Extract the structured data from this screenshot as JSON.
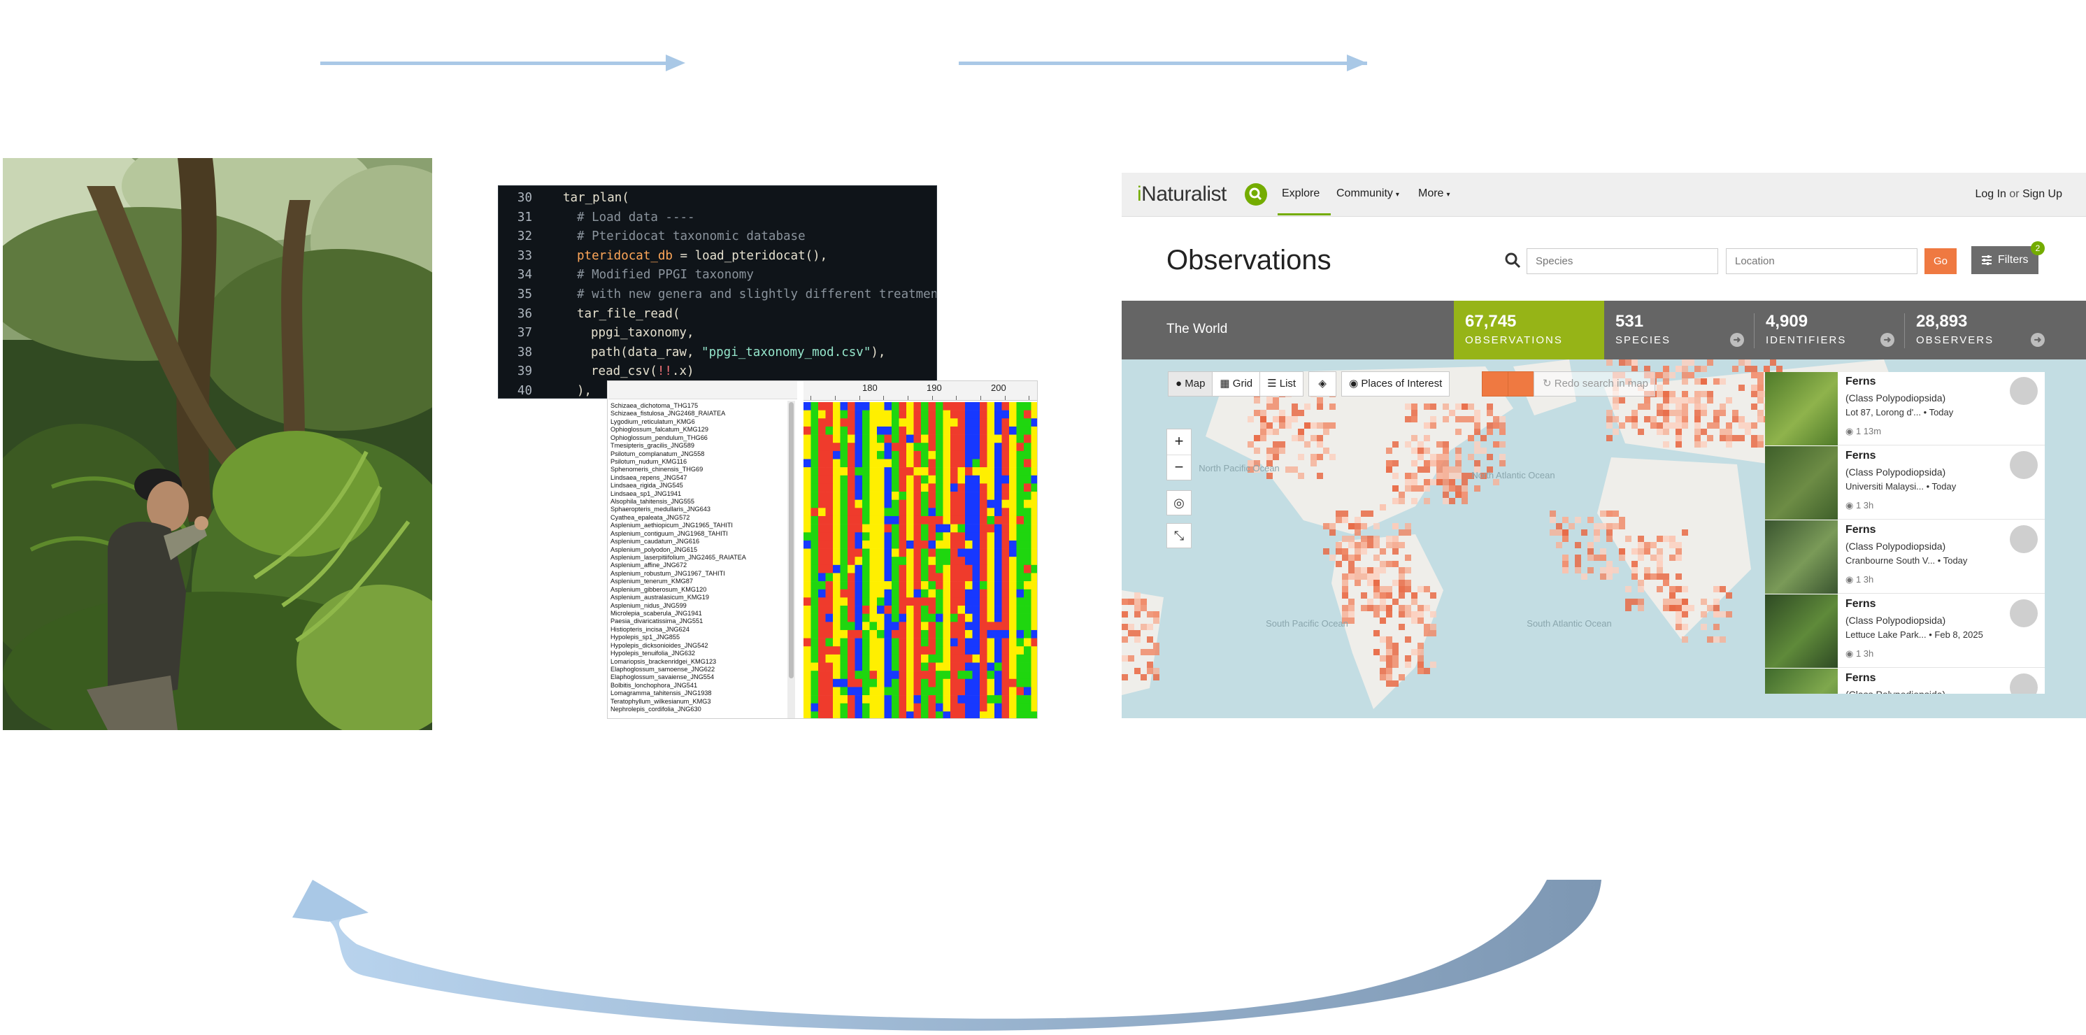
{
  "code": {
    "lines": [
      {
        "num": "30",
        "text": "tar_plan("
      },
      {
        "num": "31",
        "text": "# Load data ----"
      },
      {
        "num": "32",
        "text": "# Pteridocat taxonomic database"
      },
      {
        "num": "33",
        "text_a": "pteridocat_db",
        "text_b": " = load_pteridocat(),"
      },
      {
        "num": "34",
        "text": "# Modified PPGI taxonomy"
      },
      {
        "num": "35",
        "text": "# with new genera and slightly different treatments"
      },
      {
        "num": "36",
        "text": "tar_file_read("
      },
      {
        "num": "37",
        "text": "ppgi_taxonomy,"
      },
      {
        "num": "38",
        "text_a": "path(data_raw, ",
        "text_b": "\"ppgi_taxonomy_mod.csv\"",
        "text_c": "),"
      },
      {
        "num": "39",
        "text_a": "read_csv(",
        "text_b": "!!",
        "text_c": ".x)"
      },
      {
        "num": "40",
        "text": "),"
      }
    ]
  },
  "alignment": {
    "ruler": [
      "180",
      "190",
      "200"
    ],
    "taxa": [
      "Schizaea_dichotoma_THG175",
      "Schizaea_fistulosa_JNG2468_RAIATEA",
      "Lygodium_reticulatum_KMG6",
      "Ophioglossum_falcatum_KMG129",
      "Ophioglossum_pendulum_THG66",
      "Tmesipteris_gracilis_JNG589",
      "Psilotum_complanatum_JNG558",
      "Psilotum_nudum_KMG116",
      "Sphenomeris_chinensis_THG69",
      "Lindsaea_repens_JNG547",
      "Lindsaea_rigida_JNG545",
      "Lindsaea_sp1_JNG1941",
      "Alsophila_tahitensis_JNG555",
      "Sphaeropteris_medullaris_JNG643",
      "Cyathea_epaleata_JNG572",
      "Asplenium_aethiopicum_JNG1965_TAHITI",
      "Asplenium_contiguum_JNG1968_TAHITI",
      "Asplenium_caudatum_JNG616",
      "Asplenium_polyodon_JNG615",
      "Asplenium_laserpitiifolium_JNG2465_RAIATEA",
      "Asplenium_affine_JNG672",
      "Asplenium_robustum_JNG1967_TAHITI",
      "Asplenium_tenerum_KMG87",
      "Asplenium_gibberosum_KMG120",
      "Asplenium_australasicum_KMG19",
      "Asplenium_nidus_JNG599",
      "Microlepia_scaberula_JNG1941",
      "Paesia_divaricatissima_JNG551",
      "Histiopteris_incisa_JNG624",
      "Hypolepis_sp1_JNG855",
      "Hypolepis_dicksonioides_JNG542",
      "Hypolepis_tenuifolia_JNG632",
      "Lomariopsis_brackenridgei_KMG123",
      "Elaphoglossum_samoense_JNG622",
      "Elaphoglossum_savaiense_JNG554",
      "Bolbitis_lonchophora_JNG541",
      "Lomagramma_tahitensis_JNG1938",
      "Teratophyllum_wilkesianum_KMG3",
      "Nephrolepis_cordifolia_JNG630"
    ]
  },
  "inat": {
    "brand": "iNaturalist",
    "nav": {
      "explore": "Explore",
      "community": "Community",
      "more": "More",
      "login": "Log In",
      "or": "or",
      "signup": "Sign Up"
    },
    "title": "Observations",
    "species_placeholder": "Species",
    "location_placeholder": "Location",
    "go": "Go",
    "filters": "Filters",
    "filters_count": "2",
    "place": "The World",
    "stats": [
      {
        "num": "67,745",
        "label": "OBSERVATIONS"
      },
      {
        "num": "531",
        "label": "SPECIES"
      },
      {
        "num": "4,909",
        "label": "IDENTIFIERS"
      },
      {
        "num": "28,893",
        "label": "OBSERVERS"
      }
    ],
    "views": {
      "map": "Map",
      "grid": "Grid",
      "list": "List",
      "poi": "Places of Interest"
    },
    "redo": "Redo search in map",
    "ocean_labels": [
      "North Pacific Ocean",
      "North Atlantic Ocean",
      "South Pacific Ocean",
      "South Atlantic Ocean"
    ],
    "observations": [
      {
        "name": "Ferns",
        "cls": "(Class Polypodiopsida)",
        "place": "Lot 87, Lorong d'...",
        "date": "Today",
        "meta": "1   13m"
      },
      {
        "name": "Ferns",
        "cls": "(Class Polypodiopsida)",
        "place": "Universiti Malaysi...",
        "date": "Today",
        "meta": "1   3h"
      },
      {
        "name": "Ferns",
        "cls": "(Class Polypodiopsida)",
        "place": "Cranbourne South V...",
        "date": "Today",
        "meta": "1   3h"
      },
      {
        "name": "Ferns",
        "cls": "(Class Polypodiopsida)",
        "place": "Lettuce Lake Park...",
        "date": "Feb 8, 2025",
        "meta": "1   3h"
      },
      {
        "name": "Ferns",
        "cls": "(Class Polypodiopsida)",
        "place": "",
        "date": "",
        "meta": ""
      }
    ]
  },
  "colors": {
    "arrow_light": "#a9c8e6",
    "arrow_dark": "#7b96b4",
    "inat_green": "#74ac00",
    "obs_green": "#96b417",
    "go_orange": "#ef7941",
    "nuc_red": "#ef3b2c",
    "nuc_yellow": "#ffef00",
    "nuc_green": "#1fd60f",
    "nuc_blue": "#1738ff"
  }
}
